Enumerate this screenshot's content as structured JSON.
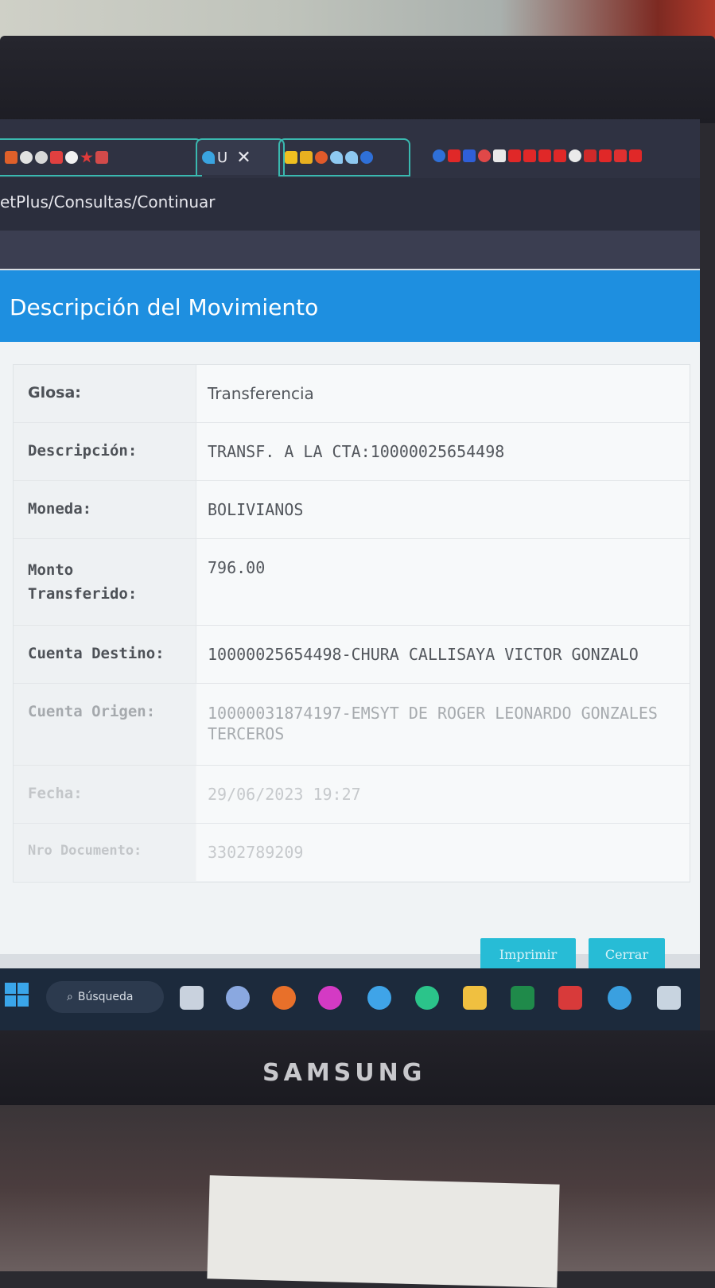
{
  "browser": {
    "active_tab_label": "U",
    "address": "etPlus/Consultas/Continuar"
  },
  "modal": {
    "title": "Descripción del Movimiento",
    "rows": [
      {
        "label": "Glosa:",
        "value": "Transferencia"
      },
      {
        "label": "Descripción:",
        "value": "TRANSF. A LA CTA:10000025654498"
      },
      {
        "label": "Moneda:",
        "value": "BOLIVIANOS"
      },
      {
        "label": "Monto Transferido:",
        "value": "796.00"
      },
      {
        "label": "Cuenta Destino:",
        "value": "10000025654498-CHURA CALLISAYA VICTOR GONZALO"
      },
      {
        "label": "Cuenta Origen:",
        "value": "10000031874197-EMSYT DE ROGER LEONARDO GONZALES TERCEROS"
      },
      {
        "label": "Fecha:",
        "value": "29/06/2023 19:27"
      },
      {
        "label": "Nro Documento:",
        "value": "3302789209"
      }
    ],
    "print_label": "Imprimir",
    "close_label": "Cerrar"
  },
  "taskbar": {
    "search_label": "Búsqueda"
  },
  "monitor": {
    "brand": "SAMSUNG"
  },
  "colors": {
    "header_blue": "#1e8fe0",
    "button_cyan": "#27bcd6",
    "tab_accent": "#3ab9b0"
  }
}
